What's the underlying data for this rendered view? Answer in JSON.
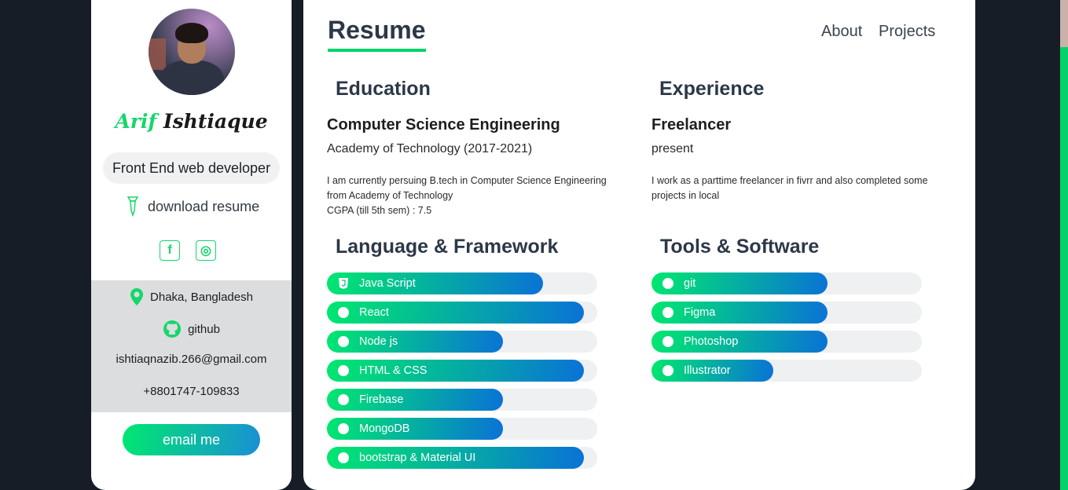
{
  "profile": {
    "first_name": "Arif",
    "last_name": "Ishtiaque",
    "role": "Front End web developer",
    "download_label": "download resume",
    "social": {
      "facebook_glyph": "f",
      "instagram_glyph": "◎"
    },
    "contact": {
      "location": "Dhaka, Bangladesh",
      "github": "github",
      "email": "ishtiaqnazib.266@gmail.com",
      "phone": "+8801747-109833"
    },
    "email_button": "email me"
  },
  "header": {
    "title": "Resume",
    "nav": {
      "about": "About",
      "projects": "Projects"
    }
  },
  "education": {
    "heading": "Education",
    "title": "Computer Science Engineering",
    "institution": "Academy of Technology (2017-2021)",
    "desc_line1": "I am currently persuing B.tech in Computer Science Engineering",
    "desc_line2": "from Academy of Technology",
    "desc_line3": "CGPA (till 5th sem) : 7.5"
  },
  "experience": {
    "heading": "Experience",
    "title": "Freelancer",
    "period": "present",
    "desc_line1": "I work as a parttime freelancer in fivrr and also completed some",
    "desc_line2": "projects in local"
  },
  "languages": {
    "heading": "Language & Framework",
    "items": [
      {
        "label": "Java Script",
        "level": 0.8
      },
      {
        "label": "React",
        "level": 0.95
      },
      {
        "label": "Node js",
        "level": 0.65
      },
      {
        "label": "HTML & CSS",
        "level": 0.95
      },
      {
        "label": "Firebase",
        "level": 0.65
      },
      {
        "label": "MongoDB",
        "level": 0.65
      },
      {
        "label": "bootstrap & Material UI",
        "level": 0.95
      }
    ]
  },
  "tools": {
    "heading": "Tools & Software",
    "items": [
      {
        "label": "git",
        "level": 0.65
      },
      {
        "label": "Figma",
        "level": 0.65
      },
      {
        "label": "Photoshop",
        "level": 0.65
      },
      {
        "label": "Illustrator",
        "level": 0.45
      }
    ]
  },
  "colors": {
    "accent": "#00d36a",
    "heading": "#2c3848",
    "background": "#171d26"
  }
}
